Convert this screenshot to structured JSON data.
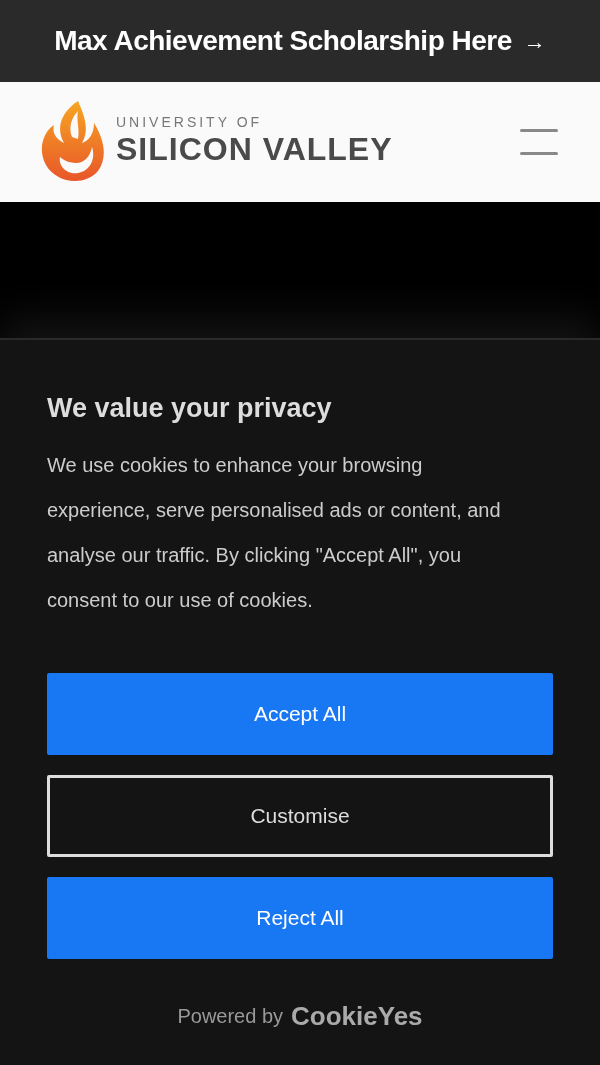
{
  "announcement": {
    "text": "Max Achievement Scholarship Here",
    "arrow": "→"
  },
  "header": {
    "logo_small": "UNIVERSITY OF",
    "logo_large": "SILICON VALLEY"
  },
  "consent": {
    "title": "We value your privacy",
    "body": "We use cookies to enhance your browsing experience, serve personalised ads or content, and analyse our traffic. By clicking \"Accept All\", you consent to our use of cookies.",
    "buttons": [
      {
        "label": "Accept All",
        "kind": "filled"
      },
      {
        "label": "Customise",
        "kind": "outline"
      },
      {
        "label": "Reject All",
        "kind": "filled"
      }
    ],
    "powered_by": "Powered by",
    "brand": "CookieYes"
  }
}
